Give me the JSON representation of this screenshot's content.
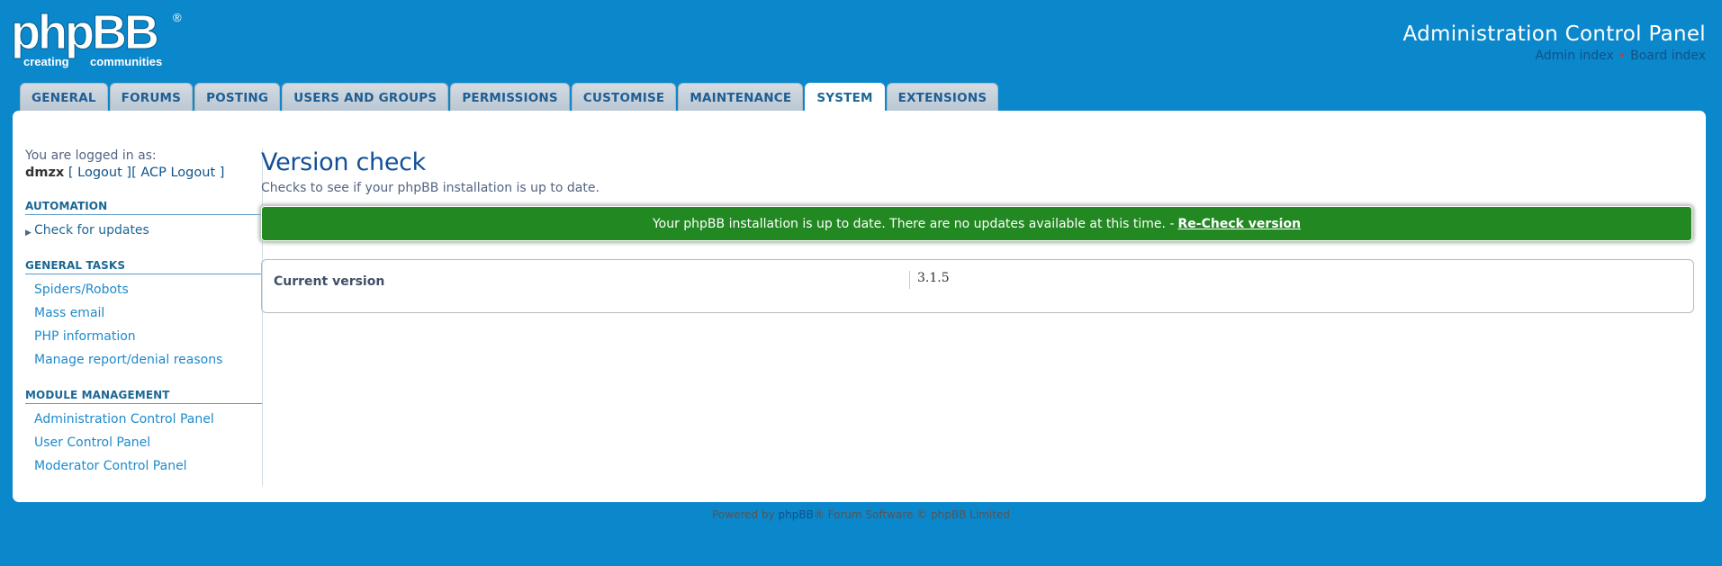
{
  "header": {
    "title": "Administration Control Panel",
    "links": [
      {
        "label": "Admin index"
      },
      {
        "label": "Board index"
      }
    ]
  },
  "logo": {
    "text": "phpBB",
    "tagline_left": "creating",
    "tagline_right": "communities",
    "mark": "®"
  },
  "tabs": [
    {
      "label": "GENERAL"
    },
    {
      "label": "FORUMS"
    },
    {
      "label": "POSTING"
    },
    {
      "label": "USERS AND GROUPS"
    },
    {
      "label": "PERMISSIONS"
    },
    {
      "label": "CUSTOMISE"
    },
    {
      "label": "MAINTENANCE"
    },
    {
      "label": "SYSTEM",
      "active": true
    },
    {
      "label": "EXTENSIONS"
    }
  ],
  "sidebar": {
    "logged_in_label": "You are logged in as:",
    "username": "dmzx",
    "logout_label": "[ Logout ]",
    "acp_logout_label": "[ ACP Logout ]",
    "sections": [
      {
        "heading": "AUTOMATION",
        "items": [
          {
            "label": "Check for updates",
            "active": true
          }
        ]
      },
      {
        "heading": "GENERAL TASKS",
        "items": [
          {
            "label": "Spiders/Robots"
          },
          {
            "label": "Mass email"
          },
          {
            "label": "PHP information"
          },
          {
            "label": "Manage report/denial reasons"
          }
        ]
      },
      {
        "heading": "MODULE MANAGEMENT",
        "items": [
          {
            "label": "Administration Control Panel"
          },
          {
            "label": "User Control Panel"
          },
          {
            "label": "Moderator Control Panel"
          }
        ]
      }
    ]
  },
  "main": {
    "title": "Version check",
    "description": "Checks to see if your phpBB installation is up to date.",
    "status_message": "Your phpBB installation is up to date. There are no updates available at this time. -",
    "recheck_label": "Re-Check version",
    "version_label": "Current version",
    "version_value": "3.1.5"
  },
  "footer": {
    "prefix": "Powered by",
    "brand": "phpBB",
    "suffix": "® Forum Software © phpBB Limited"
  },
  "colors": {
    "background": "#0b87cb",
    "success": "#228822",
    "link": "#105289"
  }
}
